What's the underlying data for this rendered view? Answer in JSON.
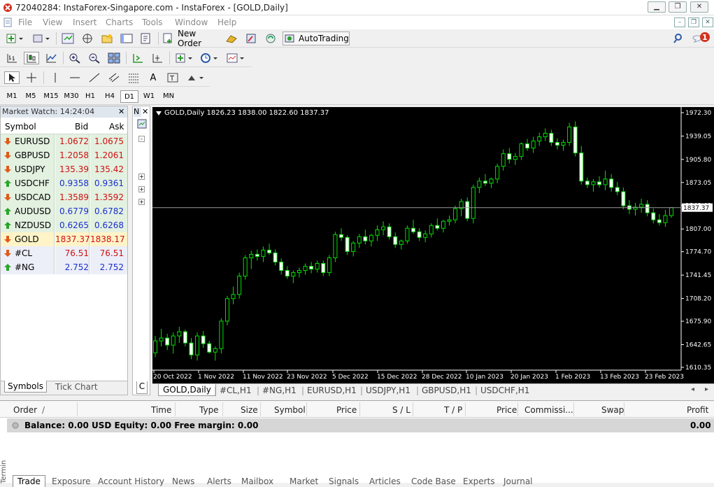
{
  "window": {
    "title": "72040284: InstaForex-Singapore.com - InstaForex - [GOLD,Daily]",
    "minimize": "▁",
    "restore": "❐",
    "close": "✕"
  },
  "menu": [
    "File",
    "View",
    "Insert",
    "Charts",
    "Tools",
    "Window",
    "Help"
  ],
  "notification_count": "1",
  "toolbar": {
    "new_order": "New Order",
    "auto_trading": "AutoTrading"
  },
  "timeframes": [
    "M1",
    "M5",
    "M15",
    "M30",
    "H1",
    "H4",
    "D1",
    "W1",
    "MN"
  ],
  "active_timeframe": "D1",
  "market_watch": {
    "title": "Market Watch: 14:24:04",
    "headers": {
      "symbol": "Symbol",
      "bid": "Bid",
      "ask": "Ask"
    },
    "rows": [
      {
        "symbol": "EURUSD",
        "bid": "1.0672",
        "ask": "1.0675",
        "dir": "down",
        "color": "#d01010"
      },
      {
        "symbol": "GBPUSD",
        "bid": "1.2058",
        "ask": "1.2061",
        "dir": "down",
        "color": "#d01010"
      },
      {
        "symbol": "USDJPY",
        "bid": "135.39",
        "ask": "135.42",
        "dir": "down",
        "color": "#d01010"
      },
      {
        "symbol": "USDCHF",
        "bid": "0.9358",
        "ask": "0.9361",
        "dir": "up",
        "color": "#1a2fd0"
      },
      {
        "symbol": "USDCAD",
        "bid": "1.3589",
        "ask": "1.3592",
        "dir": "down",
        "color": "#d01010"
      },
      {
        "symbol": "AUDUSD",
        "bid": "0.6779",
        "ask": "0.6782",
        "dir": "up",
        "color": "#1a2fd0"
      },
      {
        "symbol": "NZDUSD",
        "bid": "0.6265",
        "ask": "0.6268",
        "dir": "up",
        "color": "#1a2fd0"
      },
      {
        "symbol": "GOLD",
        "bid": "1837.37",
        "ask": "1838.17",
        "dir": "down",
        "color": "#d01010"
      },
      {
        "symbol": "#CL",
        "bid": "76.51",
        "ask": "76.51",
        "dir": "down",
        "color": "#d01010"
      },
      {
        "symbol": "#NG",
        "bid": "2.752",
        "ask": "2.752",
        "dir": "up",
        "color": "#1a2fd0"
      }
    ],
    "tabs": [
      "Symbols",
      "Tick Chart"
    ]
  },
  "navigator": {
    "title": "N",
    "tab": "C"
  },
  "chart": {
    "header": "GOLD,Daily  1826.23 1838.00 1822.60 1837.37",
    "price_ticks": [
      "1972.30",
      "1939.05",
      "1905.80",
      "1873.05",
      "1840.40",
      "1807.00",
      "1774.70",
      "1741.45",
      "1708.20",
      "1675.90",
      "1642.65",
      "1610.35"
    ],
    "current_price": "1837.37",
    "date_ticks": [
      "20 Oct 2022",
      "1 Nov 2022",
      "11 Nov 2022",
      "23 Nov 2022",
      "5 Dec 2022",
      "15 Dec 2022",
      "28 Dec 2022",
      "10 Jan 2023",
      "20 Jan 2023",
      "1 Feb 2023",
      "13 Feb 2023",
      "23 Feb 2023"
    ]
  },
  "chart_data": {
    "type": "candlestick",
    "title": "GOLD,Daily",
    "ylim": [
      1610.35,
      1972.3
    ],
    "current_price": 1837.37,
    "x_start": "20 Oct 2022",
    "x_end": "23 Feb 2023",
    "ohlc": [
      [
        1631,
        1655,
        1625,
        1648
      ],
      [
        1648,
        1665,
        1640,
        1652
      ],
      [
        1652,
        1658,
        1635,
        1642
      ],
      [
        1642,
        1660,
        1630,
        1655
      ],
      [
        1655,
        1668,
        1645,
        1661
      ],
      [
        1661,
        1664,
        1640,
        1645
      ],
      [
        1645,
        1652,
        1622,
        1628
      ],
      [
        1628,
        1660,
        1620,
        1655
      ],
      [
        1655,
        1662,
        1638,
        1644
      ],
      [
        1644,
        1648,
        1630,
        1632
      ],
      [
        1632,
        1640,
        1620,
        1637
      ],
      [
        1637,
        1680,
        1630,
        1676
      ],
      [
        1676,
        1712,
        1670,
        1708
      ],
      [
        1708,
        1725,
        1700,
        1714
      ],
      [
        1714,
        1745,
        1708,
        1740
      ],
      [
        1740,
        1770,
        1735,
        1766
      ],
      [
        1766,
        1776,
        1750,
        1771
      ],
      [
        1771,
        1778,
        1762,
        1768
      ],
      [
        1768,
        1782,
        1760,
        1777
      ],
      [
        1777,
        1786,
        1770,
        1773
      ],
      [
        1773,
        1778,
        1755,
        1760
      ],
      [
        1760,
        1765,
        1742,
        1748
      ],
      [
        1748,
        1754,
        1736,
        1740
      ],
      [
        1740,
        1748,
        1730,
        1745
      ],
      [
        1745,
        1752,
        1738,
        1748
      ],
      [
        1748,
        1758,
        1742,
        1754
      ],
      [
        1754,
        1760,
        1744,
        1750
      ],
      [
        1750,
        1762,
        1745,
        1758
      ],
      [
        1758,
        1762,
        1740,
        1745
      ],
      [
        1745,
        1770,
        1740,
        1766
      ],
      [
        1766,
        1803,
        1760,
        1799
      ],
      [
        1799,
        1808,
        1790,
        1795
      ],
      [
        1795,
        1798,
        1770,
        1775
      ],
      [
        1775,
        1790,
        1768,
        1787
      ],
      [
        1787,
        1800,
        1780,
        1796
      ],
      [
        1796,
        1806,
        1785,
        1790
      ],
      [
        1790,
        1800,
        1782,
        1798
      ],
      [
        1798,
        1812,
        1790,
        1806
      ],
      [
        1806,
        1818,
        1798,
        1810
      ],
      [
        1810,
        1815,
        1792,
        1796
      ],
      [
        1796,
        1802,
        1780,
        1785
      ],
      [
        1785,
        1792,
        1778,
        1790
      ],
      [
        1790,
        1812,
        1786,
        1808
      ],
      [
        1808,
        1820,
        1800,
        1803
      ],
      [
        1803,
        1808,
        1790,
        1795
      ],
      [
        1795,
        1805,
        1788,
        1800
      ],
      [
        1800,
        1815,
        1795,
        1812
      ],
      [
        1812,
        1822,
        1805,
        1808
      ],
      [
        1808,
        1820,
        1802,
        1818
      ],
      [
        1818,
        1826,
        1812,
        1820
      ],
      [
        1820,
        1840,
        1815,
        1836
      ],
      [
        1836,
        1850,
        1825,
        1846
      ],
      [
        1846,
        1852,
        1818,
        1822
      ],
      [
        1822,
        1870,
        1815,
        1866
      ],
      [
        1866,
        1880,
        1858,
        1875
      ],
      [
        1875,
        1885,
        1868,
        1872
      ],
      [
        1872,
        1880,
        1865,
        1878
      ],
      [
        1878,
        1900,
        1872,
        1896
      ],
      [
        1896,
        1920,
        1890,
        1914
      ],
      [
        1914,
        1922,
        1900,
        1906
      ],
      [
        1906,
        1915,
        1898,
        1910
      ],
      [
        1910,
        1930,
        1905,
        1928
      ],
      [
        1928,
        1935,
        1918,
        1922
      ],
      [
        1922,
        1938,
        1915,
        1932
      ],
      [
        1932,
        1944,
        1925,
        1938
      ],
      [
        1938,
        1950,
        1932,
        1943
      ],
      [
        1943,
        1948,
        1925,
        1930
      ],
      [
        1930,
        1936,
        1920,
        1926
      ],
      [
        1926,
        1934,
        1918,
        1930
      ],
      [
        1930,
        1958,
        1925,
        1952
      ],
      [
        1952,
        1960,
        1910,
        1915
      ],
      [
        1915,
        1925,
        1870,
        1875
      ],
      [
        1875,
        1880,
        1865,
        1870
      ],
      [
        1870,
        1878,
        1860,
        1874
      ],
      [
        1874,
        1882,
        1866,
        1870
      ],
      [
        1870,
        1890,
        1862,
        1878
      ],
      [
        1878,
        1885,
        1860,
        1866
      ],
      [
        1866,
        1874,
        1855,
        1860
      ],
      [
        1860,
        1866,
        1835,
        1840
      ],
      [
        1840,
        1848,
        1828,
        1835
      ],
      [
        1835,
        1844,
        1826,
        1838
      ],
      [
        1838,
        1850,
        1830,
        1842
      ],
      [
        1842,
        1848,
        1825,
        1830
      ],
      [
        1830,
        1836,
        1815,
        1820
      ],
      [
        1820,
        1828,
        1812,
        1816
      ],
      [
        1816,
        1834,
        1810,
        1826
      ],
      [
        1826,
        1838,
        1822.6,
        1837.37
      ]
    ]
  },
  "chart_tabs": [
    "GOLD,Daily",
    "#CL,H1",
    "#NG,H1",
    "EURUSD,H1",
    "USDJPY,H1",
    "GBPUSD,H1",
    "USDCHF,H1"
  ],
  "terminal": {
    "headers": [
      "Order",
      "Time",
      "Type",
      "Size",
      "Symbol",
      "Price",
      "S / L",
      "T / P",
      "Price",
      "Commissi...",
      "Swap",
      "Profit"
    ],
    "balance_text": "Balance: 0.00 USD  Equity: 0.00  Free margin: 0.00",
    "balance_profit": "0.00",
    "side_label": "Terminal",
    "tabs": [
      "Trade",
      "Exposure",
      "Account History",
      "News",
      "Alerts",
      "Mailbox",
      "Market",
      "Signals",
      "Articles",
      "Code Base",
      "Experts",
      "Journal"
    ]
  }
}
